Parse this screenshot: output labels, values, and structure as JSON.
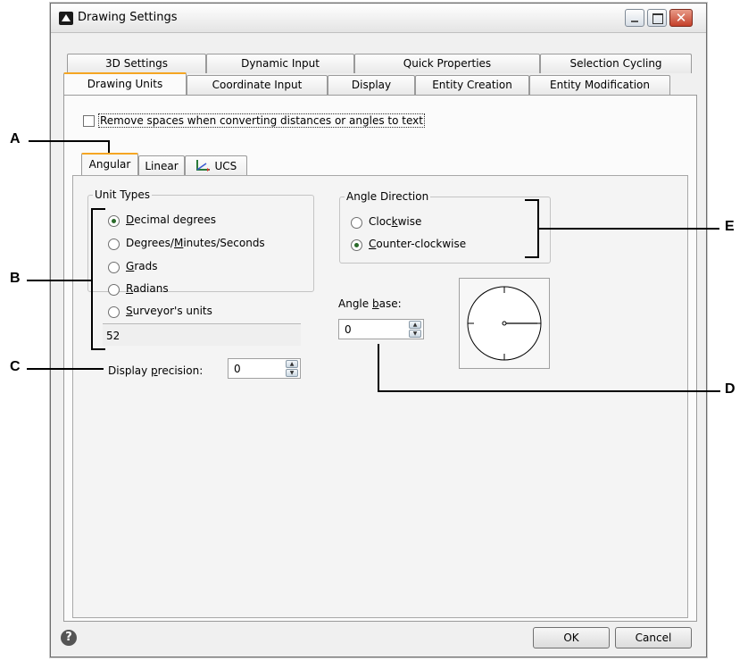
{
  "window": {
    "title": "Drawing Settings"
  },
  "tabs_back": [
    "3D Settings",
    "Dynamic Input",
    "Quick Properties",
    "Selection Cycling"
  ],
  "tabs_front": [
    "Drawing Units",
    "Coordinate Input",
    "Display",
    "Entity Creation",
    "Entity Modification"
  ],
  "remove_spaces_label": "Remove spaces when converting distances or angles to text",
  "subtabs": [
    "Angular",
    "Linear",
    "UCS"
  ],
  "unit_types": {
    "legend": "Unit Types",
    "options": [
      "Decimal degrees",
      "Degrees/Minutes/Seconds",
      "Grads",
      "Radians",
      "Surveyor's units"
    ],
    "selected": "Decimal degrees",
    "preview": "52"
  },
  "display_precision": {
    "label": "Display precision:",
    "value": "0"
  },
  "angle_direction": {
    "legend": "Angle Direction",
    "options": [
      "Clockwise",
      "Counter-clockwise"
    ],
    "selected": "Counter-clockwise"
  },
  "angle_base": {
    "label": "Angle base:",
    "value": "0"
  },
  "footer": {
    "ok": "OK",
    "cancel": "Cancel"
  },
  "callouts": [
    "A",
    "B",
    "C",
    "D",
    "E"
  ],
  "icons": [
    "app-icon",
    "minimize-icon",
    "maximize-icon",
    "close-icon",
    "ucs-icon",
    "help-icon",
    "angle-dial-icon"
  ],
  "colors": {
    "active_tab": "#f5a623",
    "close_button": "#c4402a",
    "radio_dot": "#2a6a2a"
  }
}
